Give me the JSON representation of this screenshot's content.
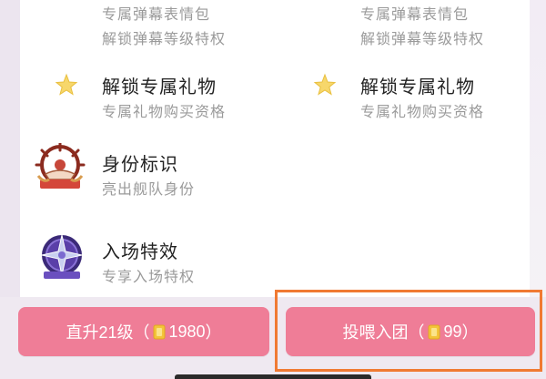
{
  "left_column": {
    "item_top_sub1": "专属弹幕表情包",
    "item_top_sub2": "解锁弹幕等级特权",
    "gift": {
      "title": "解锁专属礼物",
      "sub": "专属礼物购买资格",
      "icon": "star-icon"
    },
    "identity": {
      "title": "身份标识",
      "sub": "亮出舰队身份",
      "icon": "ship-wheel-badge-icon"
    },
    "entrance": {
      "title": "入场特效",
      "sub": "专享入场特权",
      "icon": "compass-star-badge-icon"
    }
  },
  "right_column": {
    "item_top_sub1": "专属弹幕表情包",
    "item_top_sub2": "解锁弹幕等级特权",
    "gift": {
      "title": "解锁专属礼物",
      "sub": "专属礼物购买资格",
      "icon": "star-icon"
    }
  },
  "buttons": {
    "level_up": {
      "label_prefix": "直升21级（",
      "amount": "1980",
      "label_suffix": "）",
      "icon": "coin-icon"
    },
    "join": {
      "label_prefix": "投喂入团（",
      "amount": "99",
      "label_suffix": "）",
      "icon": "coin-icon"
    }
  },
  "colors": {
    "button_pink": "#ef7d97",
    "highlight_orange": "#f07a33",
    "coin_gold": "#f3c43a"
  }
}
